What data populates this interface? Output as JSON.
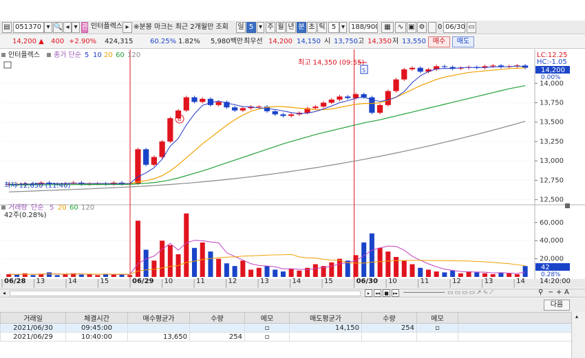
{
  "toolbar": {
    "code": "051370",
    "name": "인터플렉스",
    "notice": "※분봉 마크는 최근 2개월만 조회",
    "periods": [
      "일",
      "5",
      "주",
      "월",
      "년",
      "분",
      "초",
      "틱"
    ],
    "interval": "5",
    "count": "188/900",
    "date_check": "0",
    "date": "06/30"
  },
  "quote": {
    "price": "14,200 ▲",
    "change": "400",
    "change_pct": "+2.90%",
    "volume": "424,315",
    "vol_ratio": "60.25%",
    "turnover": "1.82%",
    "amount": "5,980백만",
    "best_ask_label": "최우선",
    "best_ask": "14,200",
    "best_bid": "14,150",
    "open_label": "시",
    "open": "13,750",
    "high_label": "고",
    "high": "14,350",
    "low_label": "저",
    "low": "13,550",
    "buy_label": "매수",
    "sell_label": "매도"
  },
  "chart_data": [
    {
      "type": "candlestick",
      "title": "인터플렉스",
      "legend": [
        {
          "name": "종가 단순",
          "color": "#9b59b6"
        },
        {
          "name": "5",
          "color": "#2238c8"
        },
        {
          "name": "10",
          "color": "#2238c8"
        },
        {
          "name": "20",
          "color": "#f0a000"
        },
        {
          "name": "60",
          "color": "#22a03a"
        },
        {
          "name": "120",
          "color": "#888888"
        }
      ],
      "x_ticks": [
        "06/28",
        "13",
        "14",
        "15",
        "06/29",
        "10",
        "11",
        "12",
        "13",
        "14",
        "15",
        "06/30",
        "10",
        "11",
        "12",
        "13",
        "14",
        "14:20:00"
      ],
      "y_ticks": [
        14000,
        13750,
        13500,
        13250,
        13000,
        12750,
        12500
      ],
      "ylim": [
        12470,
        14330
      ],
      "lc_label": "LC:12.25",
      "hc_label": "HC:-1.05",
      "current_price": "14,200",
      "current_pct": "0.00%",
      "high_annotation": "최고 14,350 (09:55)",
      "low_annotation": "최저 12,650 (11:40)",
      "series": [
        {
          "name": "close",
          "values": [
            12700,
            12690,
            12710,
            12700,
            12720,
            12705,
            12700,
            12710,
            12720,
            12700,
            12705,
            12710,
            12700,
            12720,
            12700,
            12710,
            13150,
            12950,
            13050,
            13250,
            13550,
            13650,
            13820,
            13760,
            13800,
            13720,
            13760,
            13690,
            13650,
            13680,
            13700,
            13700,
            13640,
            13600,
            13580,
            13600,
            13620,
            13680,
            13700,
            13750,
            13790,
            13830,
            13810,
            13860,
            13820,
            13620,
            13720,
            13900,
            14050,
            14180,
            14200,
            14150,
            14180,
            14220,
            14210,
            14190,
            14200,
            14210,
            14200,
            14220,
            14230,
            14210,
            14220,
            14230,
            14200
          ]
        },
        {
          "name": "MA20",
          "values": [
            12700,
            12700,
            12702,
            12703,
            12705,
            12706,
            12706,
            12708,
            12709,
            12708,
            12707,
            12707,
            12707,
            12708,
            12708,
            12708,
            12730,
            12745,
            12770,
            12810,
            12870,
            12950,
            13040,
            13130,
            13220,
            13300,
            13380,
            13460,
            13530,
            13590,
            13640,
            13670,
            13690,
            13700,
            13700,
            13690,
            13680,
            13670,
            13660,
            13660,
            13670,
            13690,
            13710,
            13730,
            13740,
            13740,
            13750,
            13780,
            13820,
            13870,
            13920,
            13970,
            14010,
            14050,
            14080,
            14100,
            14120,
            14140,
            14150,
            14160,
            14170,
            14180,
            14190,
            14195,
            14200
          ]
        },
        {
          "name": "MA60",
          "values": [
            12690,
            12690,
            12690,
            12691,
            12692,
            12692,
            12693,
            12694,
            12694,
            12695,
            12695,
            12696,
            12696,
            12697,
            12697,
            12698,
            12705,
            12712,
            12720,
            12735,
            12755,
            12780,
            12810,
            12840,
            12870,
            12905,
            12940,
            12975,
            13010,
            13045,
            13080,
            13115,
            13150,
            13185,
            13220,
            13250,
            13280,
            13310,
            13340,
            13365,
            13390,
            13415,
            13440,
            13465,
            13490,
            13510,
            13530,
            13555,
            13580,
            13605,
            13630,
            13655,
            13680,
            13705,
            13730,
            13755,
            13780,
            13805,
            13830,
            13855,
            13880,
            13905,
            13930,
            13950,
            13970
          ]
        },
        {
          "name": "MA120",
          "values": [
            12600,
            12604,
            12608,
            12612,
            12616,
            12620,
            12624,
            12628,
            12632,
            12636,
            12640,
            12645,
            12650,
            12655,
            12660,
            12665,
            12670,
            12676,
            12682,
            12689,
            12696,
            12704,
            12712,
            12721,
            12730,
            12740,
            12750,
            12761,
            12772,
            12784,
            12796,
            12809,
            12822,
            12836,
            12850,
            12865,
            12880,
            12896,
            12912,
            12929,
            12946,
            12964,
            12982,
            13001,
            13020,
            13040,
            13060,
            13081,
            13102,
            13124,
            13146,
            13169,
            13192,
            13216,
            13240,
            13265,
            13290,
            13316,
            13342,
            13369,
            13396,
            13424,
            13452,
            13481,
            13510
          ]
        }
      ]
    },
    {
      "type": "bar",
      "title": "거래량",
      "legend": [
        {
          "name": "단순",
          "color": "#9b59b6"
        },
        {
          "name": "5",
          "color": "#9b59b6"
        },
        {
          "name": "20",
          "color": "#f0a000"
        },
        {
          "name": "60",
          "color": "#22a03a"
        },
        {
          "name": "120",
          "color": "#888888"
        }
      ],
      "readout": "42주(0.28%)",
      "y_ticks": [
        60000,
        40000,
        20000
      ],
      "ylim": [
        0,
        72000
      ],
      "current_label": "42",
      "current_pct": "0.28%",
      "values": [
        3000,
        2500,
        4000,
        2000,
        3500,
        5000,
        2000,
        3000,
        4000,
        2500,
        3000,
        2000,
        3500,
        2500,
        3000,
        2000,
        62000,
        30000,
        18000,
        40000,
        35000,
        25000,
        70000,
        32000,
        38000,
        28000,
        20000,
        15000,
        12000,
        18000,
        8000,
        10000,
        12000,
        8000,
        6000,
        9000,
        7000,
        10000,
        14000,
        12000,
        16000,
        20000,
        18000,
        24000,
        38000,
        48000,
        32000,
        28000,
        22000,
        18000,
        14000,
        10000,
        8000,
        6000,
        5000,
        7000,
        4000,
        6000,
        5000,
        4000,
        3000,
        5000,
        4000,
        3000,
        12000
      ]
    }
  ],
  "tab": {
    "next_label": "다음"
  },
  "table": {
    "headers": [
      "거래일",
      "체결시간",
      "매수평균가",
      "수량",
      "메모",
      "매도평균가",
      "수량",
      "메모"
    ],
    "rows": [
      [
        "2021/06/30",
        "09:45:00",
        "",
        "",
        "",
        "14,150",
        "254",
        ""
      ],
      [
        "2021/06/29",
        "10:40:00",
        "13,650",
        "254",
        "",
        "",
        "",
        ""
      ]
    ]
  }
}
